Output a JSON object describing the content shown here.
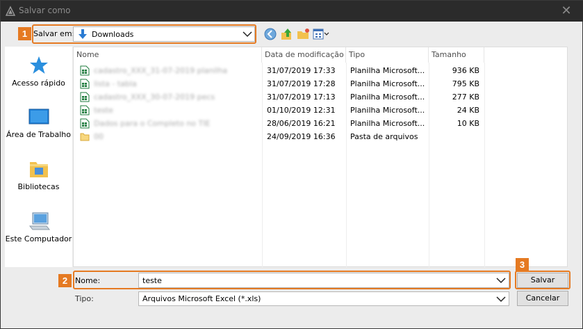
{
  "window": {
    "title": "Salvar como",
    "close_glyph": "✕"
  },
  "annotations": {
    "step1": "1",
    "step2": "2",
    "step3": "3",
    "accent": "#e57a22"
  },
  "save_in": {
    "label": "Salvar em:",
    "value": "Downloads"
  },
  "toolbar": [
    "back-icon",
    "up-folder-icon",
    "new-folder-icon",
    "view-menu-icon"
  ],
  "places": [
    {
      "label": "Acesso rápido",
      "icon": "star-icon"
    },
    {
      "label": "Área de Trabalho",
      "icon": "desktop-icon"
    },
    {
      "label": "Bibliotecas",
      "icon": "libraries-icon"
    },
    {
      "label": "Este Computador",
      "icon": "computer-icon"
    }
  ],
  "columns": {
    "name": "Nome",
    "date": "Data de modificação",
    "type": "Tipo",
    "size": "Tamanho"
  },
  "files": [
    {
      "name": "cadastro_XXX_31-07-2019 planilha",
      "date": "31/07/2019 17:33",
      "type": "Planilha Microsoft...",
      "size": "936 KB",
      "kind": "excel"
    },
    {
      "name": "lista - tabla",
      "date": "31/07/2019 17:28",
      "type": "Planilha Microsoft...",
      "size": "795 KB",
      "kind": "excel"
    },
    {
      "name": "cadastro_XXX_30-07-2019 pecs",
      "date": "31/07/2019 17:13",
      "type": "Planilha Microsoft...",
      "size": "277 KB",
      "kind": "excel"
    },
    {
      "name": "teste",
      "date": "01/10/2019 12:31",
      "type": "Planilha Microsoft...",
      "size": "24 KB",
      "kind": "excel"
    },
    {
      "name": "Dados para o Completo no TIE",
      "date": "28/06/2019 16:21",
      "type": "Planilha Microsoft...",
      "size": "10 KB",
      "kind": "excel"
    },
    {
      "name": "00",
      "date": "24/09/2019 16:36",
      "type": "Pasta de arquivos",
      "size": "",
      "kind": "folder"
    }
  ],
  "filename": {
    "label": "Nome:",
    "value": "teste"
  },
  "filetype": {
    "label": "Tipo:",
    "value": "Arquivos Microsoft Excel (*.xls)"
  },
  "buttons": {
    "save": "Salvar",
    "cancel": "Cancelar"
  }
}
